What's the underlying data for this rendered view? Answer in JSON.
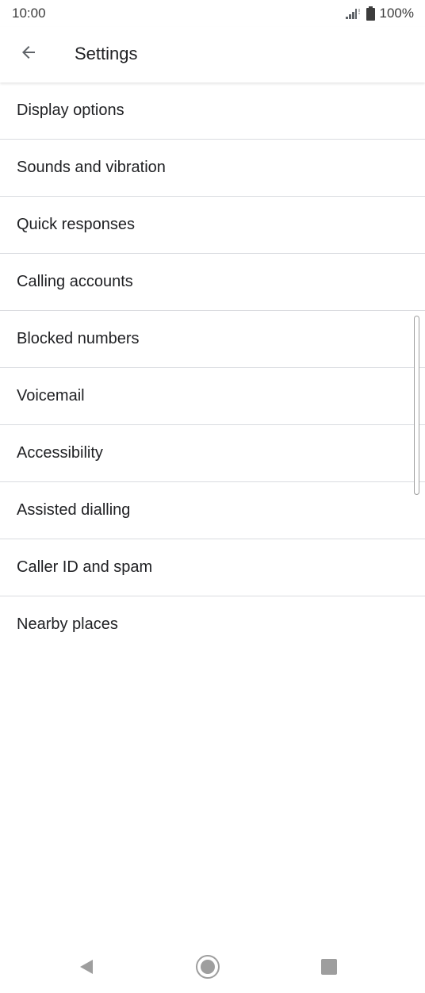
{
  "status_bar": {
    "time": "10:00",
    "battery": "100%",
    "icons": [
      "signal-icon",
      "battery-icon"
    ]
  },
  "app_bar": {
    "back_icon": "arrow-back-icon",
    "title": "Settings"
  },
  "settings": {
    "items": [
      {
        "label": "Display options"
      },
      {
        "label": "Sounds and vibration"
      },
      {
        "label": "Quick responses"
      },
      {
        "label": "Calling accounts"
      },
      {
        "label": "Blocked numbers"
      },
      {
        "label": "Voicemail"
      },
      {
        "label": "Accessibility"
      },
      {
        "label": "Assisted dialling"
      },
      {
        "label": "Caller ID and spam"
      },
      {
        "label": "Nearby places"
      }
    ]
  },
  "nav_bar": {
    "icons": [
      "back-triangle-icon",
      "home-circle-icon",
      "recents-square-icon"
    ]
  },
  "colors": {
    "divider": "#dadce0",
    "text": "#202124",
    "nav_icon": "#9e9e9e"
  }
}
